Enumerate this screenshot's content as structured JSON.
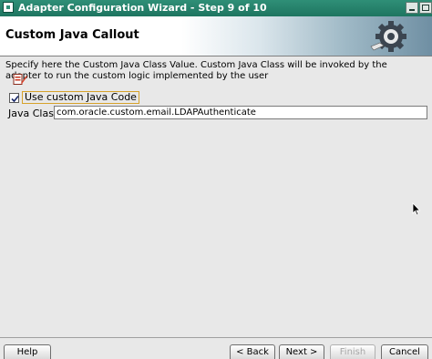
{
  "window": {
    "title": "Adapter Configuration Wizard - Step 9 of 10"
  },
  "header": {
    "title": "Custom Java Callout",
    "icon": "gear-icon"
  },
  "description": "Specify here the Custom Java Class Value. Custom Java Class will be invoked by the adapter to run the custom logic implemented by the user",
  "form": {
    "use_custom_checkbox": {
      "label": "Use custom Java Code",
      "checked": true
    },
    "java_class": {
      "label": "Java Class:",
      "value": "com.oracle.custom.email.LDAPAuthenticate"
    }
  },
  "buttons": {
    "help": "Help",
    "back": "< Back",
    "next": "Next >",
    "finish": "Finish",
    "cancel": "Cancel"
  },
  "colors": {
    "titlebar": "#2f8f77",
    "focus_border": "#d6a22b"
  }
}
